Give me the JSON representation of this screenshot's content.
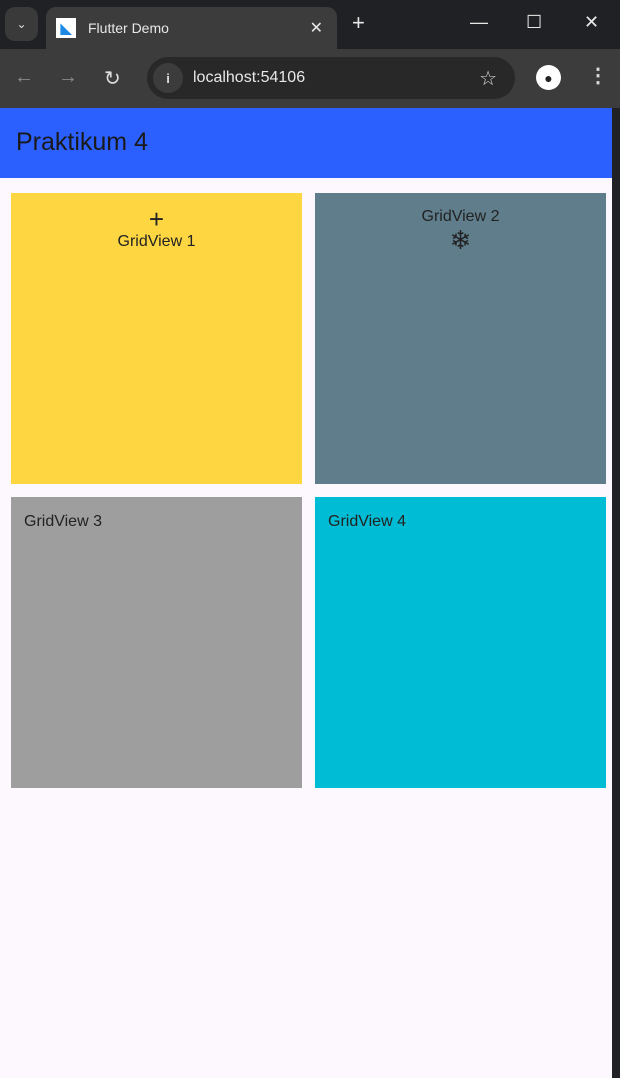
{
  "browser": {
    "tab_title": "Flutter Demo",
    "url": "localhost:54106"
  },
  "app": {
    "title": "Praktikum 4"
  },
  "tiles": [
    {
      "label": "GridView 1",
      "icon": "add-icon",
      "color": "#FDD641"
    },
    {
      "label": "GridView 2",
      "icon": "ac-unit-icon",
      "color": "#607D8B"
    },
    {
      "label": "GridView 3",
      "color": "#9E9E9E"
    },
    {
      "label": "GridView 4",
      "color": "#00BCD4"
    }
  ]
}
